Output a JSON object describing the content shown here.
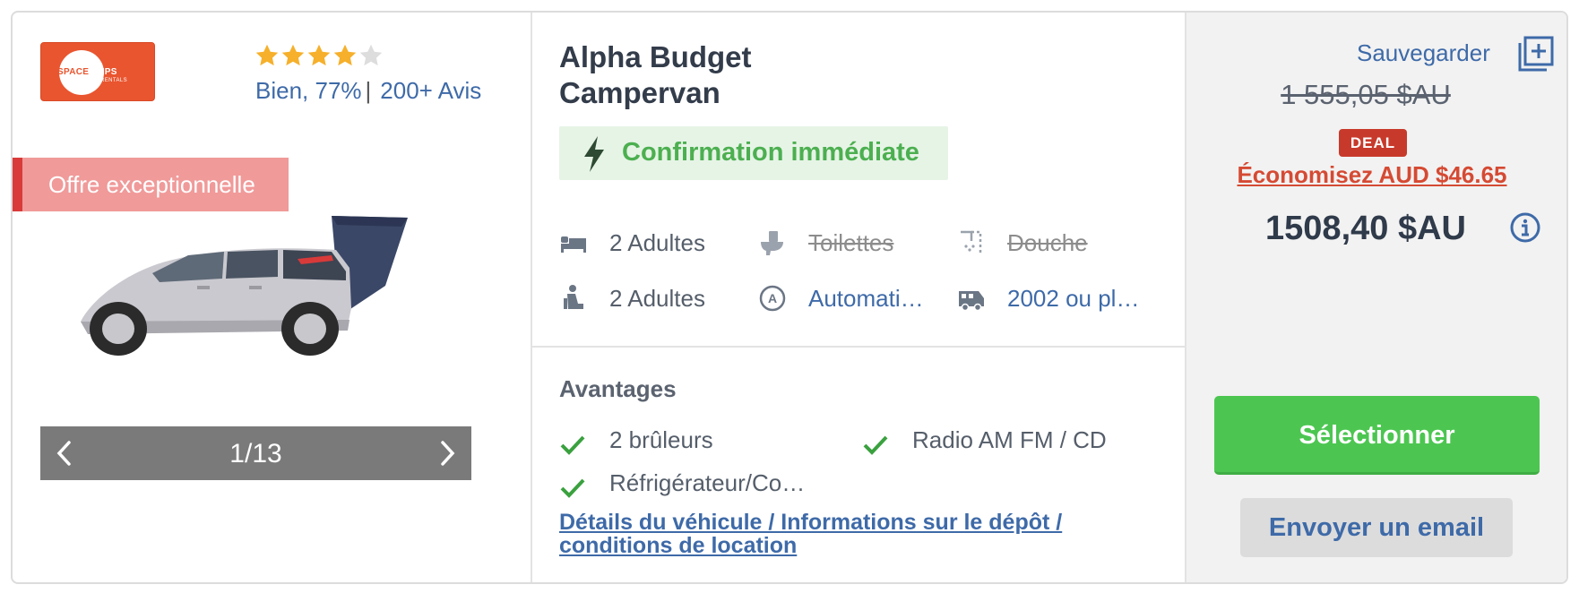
{
  "brand": {
    "logo_text_part1": "SPACE",
    "logo_text_part2": "SHIPS",
    "logo_sub": "RENTALS",
    "accent_color": "#e9552f"
  },
  "rating": {
    "stars_filled": 4,
    "stars_total": 5,
    "label": "Bien, 77%",
    "separator": "|",
    "reviews": "200+ Avis"
  },
  "offer_label": "Offre exceptionnelle",
  "gallery": {
    "counter": "1/13",
    "prev_icon": "chevron-left-icon",
    "next_icon": "chevron-right-icon"
  },
  "vehicle": {
    "title_line1": "Alpha Budget",
    "title_line2": "Campervan",
    "confirmation": "Confirmation immédiate",
    "features": [
      {
        "icon": "bed-icon",
        "label": "2 Adultes"
      },
      {
        "icon": "toilet-icon",
        "label": "Toilettes",
        "strike": true
      },
      {
        "icon": "shower-icon",
        "label": "Douche",
        "strike": true
      },
      {
        "icon": "seat-icon",
        "label": "2 Adultes"
      },
      {
        "icon": "transmission-icon",
        "label": "Automati…"
      },
      {
        "icon": "camper-icon",
        "label": "2002 ou pl…"
      }
    ],
    "advantages_title": "Avantages",
    "advantages": [
      "2 brûleurs",
      "Radio AM FM / CD",
      "Réfrigérateur/Co…"
    ],
    "details_link": "Détails du véhicule / Informations sur le dépôt / conditions de location"
  },
  "pricing": {
    "save_label": "Sauvegarder",
    "old_price": "1 555,05 $AU",
    "deal_badge": "DEAL",
    "savings": "Économisez AUD $46.65",
    "price": "1508,40 $AU",
    "select_button": "Sélectionner",
    "email_button": "Envoyer un email",
    "colors": {
      "green": "#4cc651",
      "deal_red": "#c73a2b",
      "link_blue": "#3e6aa8"
    }
  }
}
